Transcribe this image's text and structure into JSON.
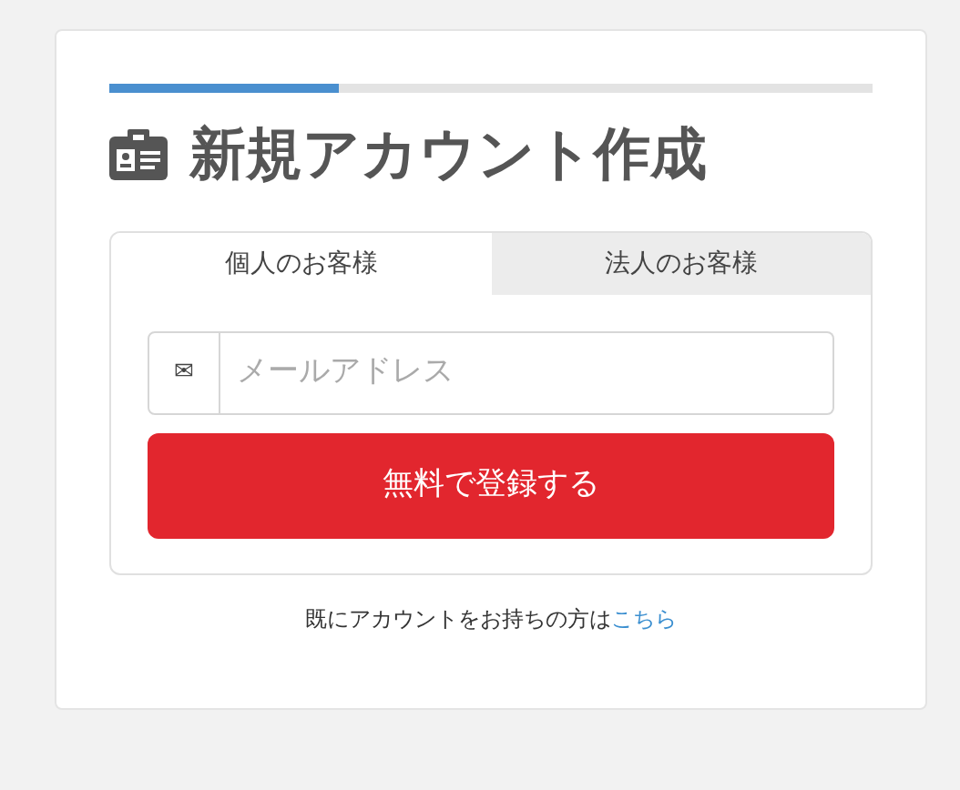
{
  "progress": {
    "level": 0.3
  },
  "title": "新規アカウント作成",
  "tabs": [
    {
      "label": "個人のお客様",
      "selected": true
    },
    {
      "label": "法人のお客様",
      "selected": false
    }
  ],
  "email": {
    "icon": "✉",
    "placeholder": "メールアドレス"
  },
  "submit_button": "無料で登録する",
  "login_prompt": {
    "text": "既にアカウントをお持ちの方は",
    "link": "こちら"
  }
}
